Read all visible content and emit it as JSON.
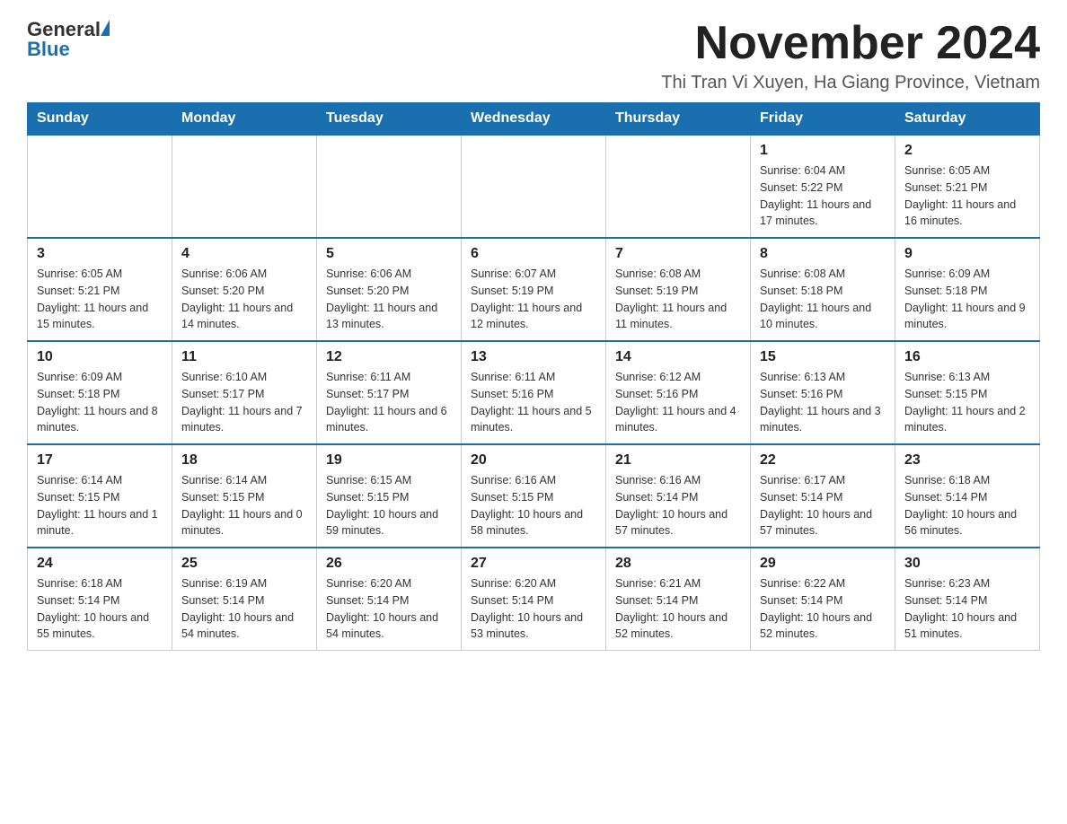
{
  "header": {
    "logo": {
      "general": "General",
      "blue": "Blue"
    },
    "title": "November 2024",
    "subtitle": "Thi Tran Vi Xuyen, Ha Giang Province, Vietnam"
  },
  "days_of_week": [
    "Sunday",
    "Monday",
    "Tuesday",
    "Wednesday",
    "Thursday",
    "Friday",
    "Saturday"
  ],
  "weeks": [
    [
      {
        "day": "",
        "info": ""
      },
      {
        "day": "",
        "info": ""
      },
      {
        "day": "",
        "info": ""
      },
      {
        "day": "",
        "info": ""
      },
      {
        "day": "",
        "info": ""
      },
      {
        "day": "1",
        "info": "Sunrise: 6:04 AM\nSunset: 5:22 PM\nDaylight: 11 hours and 17 minutes."
      },
      {
        "day": "2",
        "info": "Sunrise: 6:05 AM\nSunset: 5:21 PM\nDaylight: 11 hours and 16 minutes."
      }
    ],
    [
      {
        "day": "3",
        "info": "Sunrise: 6:05 AM\nSunset: 5:21 PM\nDaylight: 11 hours and 15 minutes."
      },
      {
        "day": "4",
        "info": "Sunrise: 6:06 AM\nSunset: 5:20 PM\nDaylight: 11 hours and 14 minutes."
      },
      {
        "day": "5",
        "info": "Sunrise: 6:06 AM\nSunset: 5:20 PM\nDaylight: 11 hours and 13 minutes."
      },
      {
        "day": "6",
        "info": "Sunrise: 6:07 AM\nSunset: 5:19 PM\nDaylight: 11 hours and 12 minutes."
      },
      {
        "day": "7",
        "info": "Sunrise: 6:08 AM\nSunset: 5:19 PM\nDaylight: 11 hours and 11 minutes."
      },
      {
        "day": "8",
        "info": "Sunrise: 6:08 AM\nSunset: 5:18 PM\nDaylight: 11 hours and 10 minutes."
      },
      {
        "day": "9",
        "info": "Sunrise: 6:09 AM\nSunset: 5:18 PM\nDaylight: 11 hours and 9 minutes."
      }
    ],
    [
      {
        "day": "10",
        "info": "Sunrise: 6:09 AM\nSunset: 5:18 PM\nDaylight: 11 hours and 8 minutes."
      },
      {
        "day": "11",
        "info": "Sunrise: 6:10 AM\nSunset: 5:17 PM\nDaylight: 11 hours and 7 minutes."
      },
      {
        "day": "12",
        "info": "Sunrise: 6:11 AM\nSunset: 5:17 PM\nDaylight: 11 hours and 6 minutes."
      },
      {
        "day": "13",
        "info": "Sunrise: 6:11 AM\nSunset: 5:16 PM\nDaylight: 11 hours and 5 minutes."
      },
      {
        "day": "14",
        "info": "Sunrise: 6:12 AM\nSunset: 5:16 PM\nDaylight: 11 hours and 4 minutes."
      },
      {
        "day": "15",
        "info": "Sunrise: 6:13 AM\nSunset: 5:16 PM\nDaylight: 11 hours and 3 minutes."
      },
      {
        "day": "16",
        "info": "Sunrise: 6:13 AM\nSunset: 5:15 PM\nDaylight: 11 hours and 2 minutes."
      }
    ],
    [
      {
        "day": "17",
        "info": "Sunrise: 6:14 AM\nSunset: 5:15 PM\nDaylight: 11 hours and 1 minute."
      },
      {
        "day": "18",
        "info": "Sunrise: 6:14 AM\nSunset: 5:15 PM\nDaylight: 11 hours and 0 minutes."
      },
      {
        "day": "19",
        "info": "Sunrise: 6:15 AM\nSunset: 5:15 PM\nDaylight: 10 hours and 59 minutes."
      },
      {
        "day": "20",
        "info": "Sunrise: 6:16 AM\nSunset: 5:15 PM\nDaylight: 10 hours and 58 minutes."
      },
      {
        "day": "21",
        "info": "Sunrise: 6:16 AM\nSunset: 5:14 PM\nDaylight: 10 hours and 57 minutes."
      },
      {
        "day": "22",
        "info": "Sunrise: 6:17 AM\nSunset: 5:14 PM\nDaylight: 10 hours and 57 minutes."
      },
      {
        "day": "23",
        "info": "Sunrise: 6:18 AM\nSunset: 5:14 PM\nDaylight: 10 hours and 56 minutes."
      }
    ],
    [
      {
        "day": "24",
        "info": "Sunrise: 6:18 AM\nSunset: 5:14 PM\nDaylight: 10 hours and 55 minutes."
      },
      {
        "day": "25",
        "info": "Sunrise: 6:19 AM\nSunset: 5:14 PM\nDaylight: 10 hours and 54 minutes."
      },
      {
        "day": "26",
        "info": "Sunrise: 6:20 AM\nSunset: 5:14 PM\nDaylight: 10 hours and 54 minutes."
      },
      {
        "day": "27",
        "info": "Sunrise: 6:20 AM\nSunset: 5:14 PM\nDaylight: 10 hours and 53 minutes."
      },
      {
        "day": "28",
        "info": "Sunrise: 6:21 AM\nSunset: 5:14 PM\nDaylight: 10 hours and 52 minutes."
      },
      {
        "day": "29",
        "info": "Sunrise: 6:22 AM\nSunset: 5:14 PM\nDaylight: 10 hours and 52 minutes."
      },
      {
        "day": "30",
        "info": "Sunrise: 6:23 AM\nSunset: 5:14 PM\nDaylight: 10 hours and 51 minutes."
      }
    ]
  ]
}
